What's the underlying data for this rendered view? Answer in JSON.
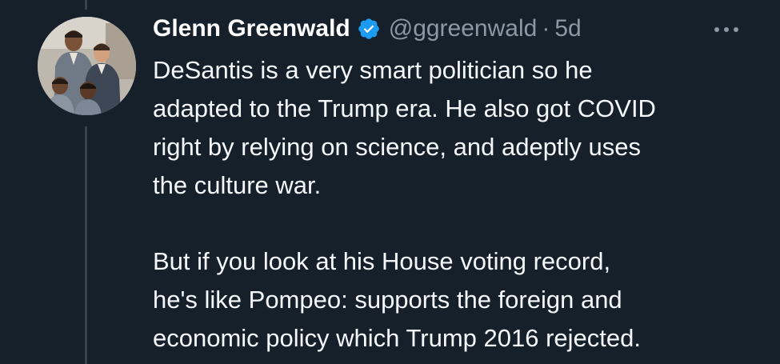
{
  "tweet": {
    "author": {
      "display_name": "Glenn Greenwald",
      "handle": "@ggreenwald",
      "verified": true,
      "avatar": "family-photo-avatar"
    },
    "separator": "·",
    "timestamp": "5d",
    "more_icon": "more-horizontal-icon",
    "paragraphs": [
      {
        "lines": [
          "DeSantis is a very smart politician so he",
          "adapted to the Trump era. He also got COVID",
          "right by relying on science, and adeptly uses",
          "the culture war."
        ]
      },
      {
        "lines": [
          "But if you look at his House voting record,",
          "he's like Pompeo: supports the foreign and",
          "economic policy which Trump 2016 rejected."
        ]
      }
    ]
  },
  "colors": {
    "background": "#15202b",
    "text": "#f5f8fa",
    "secondary_text": "#8b98a5",
    "verified_badge": "#1d9bf0",
    "thread_line": "#38444d"
  }
}
